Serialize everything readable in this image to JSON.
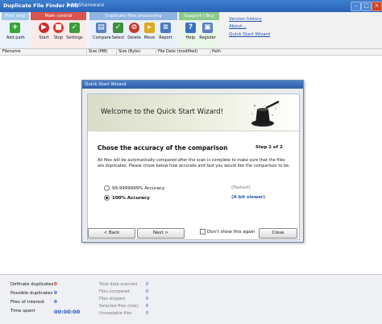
{
  "window": {
    "title": "Duplicate File Finder PRO",
    "version": "2.40 Shareware",
    "min_label": "–",
    "max_label": "□",
    "close_label": "×"
  },
  "toolbar": {
    "groups": [
      {
        "name": "First step",
        "color": "#9ec7ea"
      },
      {
        "name": "Main control",
        "color": "#d9534f"
      },
      {
        "name": "Duplicate files processing",
        "color": "#8fb3e3"
      },
      {
        "name": "Support / Buy",
        "color": "#8cc98c"
      }
    ],
    "buttons": {
      "add_path": "Add path",
      "start": "Start",
      "stop": "Stop",
      "settings": "Settings",
      "compare": "Compare",
      "select": "Select",
      "delete": "Delete",
      "move": "Move",
      "report": "Report",
      "help": "Help",
      "register": "Register"
    },
    "links": {
      "version_history": "Version history",
      "about": "About...",
      "quick_start": "Quick Start Wizard"
    }
  },
  "grid": {
    "columns": [
      "Filename",
      "Size (MB)",
      "Size (Byte)",
      "File Date (modified)",
      "Path"
    ]
  },
  "dialog": {
    "title": "Quick Start Wizard",
    "banner": "Welcome to the Quick Start Wizard!",
    "heading": "Chose the accuracy of the comparison",
    "step": "Step 2 of 2",
    "description": "All files will be automatically compared after the scan is complete to make sure that the files are duplicates. Please chose below how accurate and fast you would like the comparison to be.",
    "options": [
      {
        "label": "99.9999999% Accuracy",
        "note": "(Fastest)",
        "selected": false
      },
      {
        "label": "100% Accuracy",
        "note": "(A bit slower)",
        "selected": true
      }
    ],
    "back": "< Back",
    "next": "Next >",
    "dont_show": "Don't show this again",
    "close": "Close"
  },
  "status": {
    "definite_label": "Definate duplicates",
    "definite_value": "0",
    "possible_label": "Possible duplicates",
    "possible_value": "0",
    "interest_label": "Files of interest",
    "interest_value": "0",
    "time_label": "Time spent",
    "time_value": "00:00:00",
    "stats": [
      {
        "label": "Total data scanned",
        "value": "0"
      },
      {
        "label": "Files compared",
        "value": "0"
      },
      {
        "label": "Files skipped",
        "value": "0"
      },
      {
        "label": "Selected files (size)",
        "value": "0"
      },
      {
        "label": "Unreadable files",
        "value": "0"
      }
    ]
  }
}
